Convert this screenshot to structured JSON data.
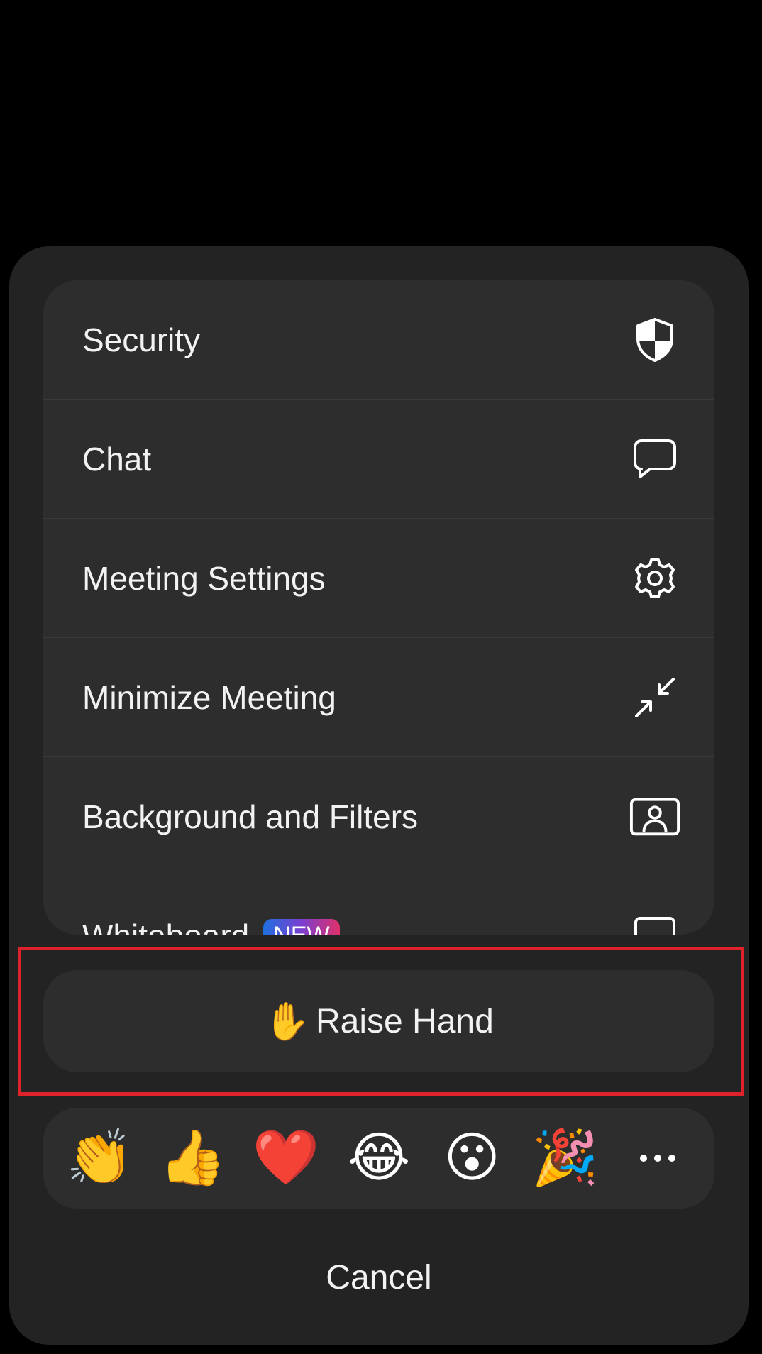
{
  "menu": {
    "items": [
      {
        "label": "Security",
        "icon": "shield-icon"
      },
      {
        "label": "Chat",
        "icon": "chat-bubble-icon"
      },
      {
        "label": "Meeting Settings",
        "icon": "gear-icon"
      },
      {
        "label": "Minimize Meeting",
        "icon": "minimize-arrows-icon"
      },
      {
        "label": "Background and Filters",
        "icon": "portrait-frame-icon"
      },
      {
        "label": "Whiteboard",
        "badge": "NEW",
        "icon": "whiteboard-icon"
      }
    ]
  },
  "raise_hand": {
    "emoji": "✋",
    "label": "Raise Hand"
  },
  "reactions": {
    "items": [
      {
        "emoji": "👏",
        "name": "clap"
      },
      {
        "emoji": "👍",
        "name": "thumbs-up"
      },
      {
        "emoji": "❤️",
        "name": "heart"
      },
      {
        "emoji": "😂",
        "name": "tears-of-joy"
      },
      {
        "emoji": "😮",
        "name": "open-mouth"
      },
      {
        "emoji": "🎉",
        "name": "party-popper"
      }
    ],
    "more_icon": "more-horizontal-icon"
  },
  "cancel_label": "Cancel",
  "colors": {
    "background": "#000000",
    "sheet": "#232323",
    "card": "#2d2d2d",
    "highlight_border": "#e0232b",
    "text": "#f2f2f2"
  }
}
